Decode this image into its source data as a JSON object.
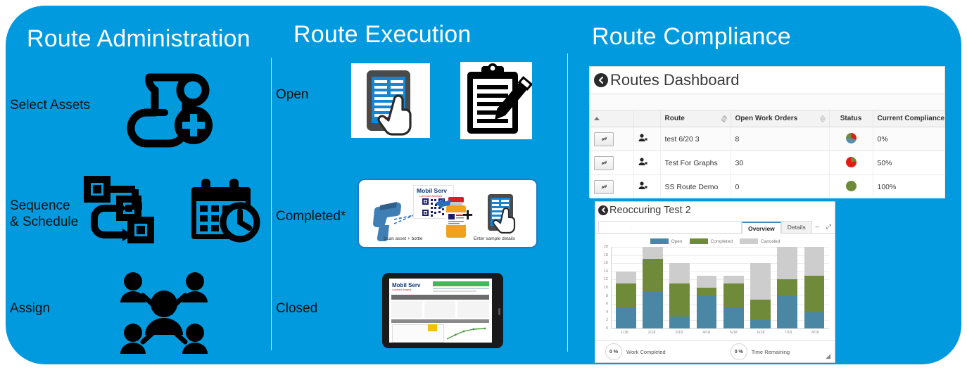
{
  "theme": {
    "brand_blue": "#029ADF",
    "link_blue": "#2a6fb5",
    "bar_open": "#4a87a4",
    "bar_completed": "#6f8b3a",
    "bar_canceled": "#cdcdcd",
    "status_red": "#e21c12",
    "status_green": "#6f8b3a",
    "status_blue": "#5b8fa8"
  },
  "columns": {
    "administration": {
      "title": "Route Administration",
      "rows": [
        {
          "label": "Select Assets",
          "icon": "scroll-plus-icon"
        },
        {
          "label": "Sequence\n& Schedule",
          "icon": "flowchart-icon"
        },
        {
          "label": "Assign",
          "icon": "people-network-icon"
        }
      ]
    },
    "execution": {
      "title": "Route Execution",
      "rows": [
        {
          "label": "Open",
          "icon": "tablet-tap-icon"
        },
        {
          "label": "Completed*",
          "icon": "scan-sample-icon"
        },
        {
          "label": "Closed",
          "icon": "tablet-report-icon"
        }
      ]
    },
    "compliance": {
      "title": "Route Compliance"
    }
  },
  "completed_card": {
    "brand_name": "Mobil Serv",
    "brand_sub": "Lubricant Analysis",
    "plus_sign": "+",
    "caption_left": "Scan asset + bottle",
    "caption_right": "Enter sample details"
  },
  "closed_card": {
    "brand_name": "Mobil Serv",
    "brand_sub": "Lubricant Analysis"
  },
  "dashboard": {
    "title": "Routes Dashboard",
    "back_icon": "back-arrow-icon",
    "table": {
      "headers": [
        "",
        "",
        "Route",
        "Open Work Orders",
        "Status",
        "Current Compliance"
      ],
      "rows": [
        {
          "chain_icon": "chain-link-icon",
          "user_icon": "user-remove-icon",
          "route": "test 6/20 3",
          "open_work_orders": "8",
          "status_icon": "pie-status-icon",
          "status_slices": [
            {
              "color": "#e21c12",
              "pct": 30
            },
            {
              "color": "#5b8fa8",
              "pct": 45
            },
            {
              "color": "#6f8b3a",
              "pct": 25
            }
          ],
          "current_compliance": "0%"
        },
        {
          "chain_icon": "chain-link-icon",
          "user_icon": "user-remove-icon",
          "route": "Test For Graphs",
          "open_work_orders": "30",
          "status_icon": "pie-status-icon",
          "status_slices": [
            {
              "color": "#e21c12",
              "pct": 78
            },
            {
              "color": "#6f8b3a",
              "pct": 22
            }
          ],
          "current_compliance": "50%"
        },
        {
          "chain_icon": "chain-link-icon",
          "user_icon": "user-remove-icon",
          "route": "SS Route Demo",
          "open_work_orders": "0",
          "status_icon": "pie-status-icon",
          "status_slices": [
            {
              "color": "#6f8b3a",
              "pct": 100
            }
          ],
          "current_compliance": "100%"
        }
      ]
    }
  },
  "chart_panel": {
    "title": "Reoccuring Test 2",
    "back_icon": "back-arrow-icon",
    "tabs": [
      {
        "label": "Overview",
        "active": true
      },
      {
        "label": "Details",
        "active": false
      }
    ],
    "window_icons": [
      {
        "name": "minimize-icon",
        "glyph": "–"
      },
      {
        "name": "expand-icon",
        "glyph": "⤢"
      }
    ],
    "footer": [
      {
        "pct": "0 %",
        "label": "Work Completed"
      },
      {
        "pct": "0 %",
        "label": "Time Remaining"
      }
    ],
    "resize_handle_icon": "resize-handle-icon"
  },
  "chart_data": {
    "type": "bar",
    "title": "Reoccuring Test 2",
    "stacked": true,
    "xlabel": "",
    "ylabel": "",
    "ylim": [
      0,
      20
    ],
    "yticks": [
      0,
      2,
      4,
      6,
      8,
      10,
      12,
      14,
      16,
      18,
      20
    ],
    "grid": true,
    "legend_position": "top-center",
    "categories": [
      "1/18",
      "2/18",
      "3/18",
      "4/18",
      "5/18",
      "6/18",
      "7/18",
      "8/18"
    ],
    "series": [
      {
        "name": "Open",
        "color": "#4a87a4",
        "values": [
          5,
          9,
          3,
          8,
          5,
          2,
          8,
          4
        ]
      },
      {
        "name": "Completed",
        "color": "#6f8b3a",
        "values": [
          6,
          8,
          8,
          2,
          6,
          5,
          4,
          9
        ]
      },
      {
        "name": "Canceled",
        "color": "#cdcdcd",
        "values": [
          3,
          3,
          5,
          3,
          2,
          9,
          8,
          7
        ]
      }
    ]
  }
}
